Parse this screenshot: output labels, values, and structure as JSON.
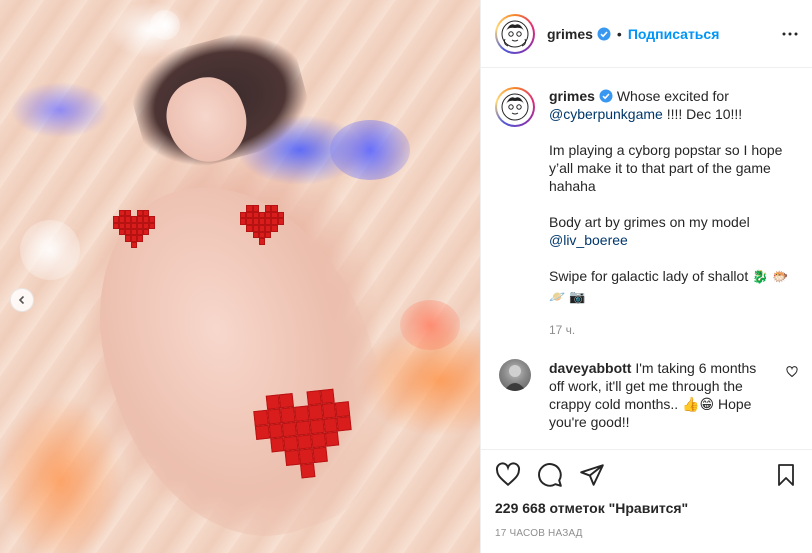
{
  "post": {
    "author": {
      "username": "grimes",
      "verified": true
    },
    "header": {
      "separator": "•",
      "follow_label": "Подписаться"
    },
    "caption": {
      "username": "grimes",
      "line1_text": "Whose excited for",
      "line1_mention": "@cyberpunkgame",
      "line1_tail": "!!!! Dec 10!!!",
      "paragraph2": "Im playing a cyborg popstar so I hope y’all make it to that part of the game hahaha",
      "paragraph3_text": "Body art by grimes on my model",
      "paragraph3_mention": "@liv_boeree",
      "paragraph4_text": "Swipe for galactic lady of shallot",
      "paragraph4_emojis": "🐉 🐡 🪐 📷",
      "time": "17 ч."
    },
    "comment": {
      "username": "daveyabbott",
      "text": "I'm taking 6 months off work, it'll get me through the crappy cold months.. 👍😁 Hope you're good!!"
    },
    "likes_text": "229 668 отметок \"Нравится\"",
    "posted_time": "17 ЧАСОВ НАЗАД",
    "icons": {
      "verified": "verified-badge-icon",
      "more": "more-options-icon",
      "prev": "chevron-left-icon",
      "like": "heart-icon",
      "comment": "comment-icon",
      "share": "paper-plane-icon",
      "save": "bookmark-icon"
    },
    "colors": {
      "link_blue": "#0095f6",
      "mention_blue": "#00376b",
      "muted": "#8e8e8e",
      "text": "#262626",
      "heart_red": "#d91c1c"
    }
  }
}
